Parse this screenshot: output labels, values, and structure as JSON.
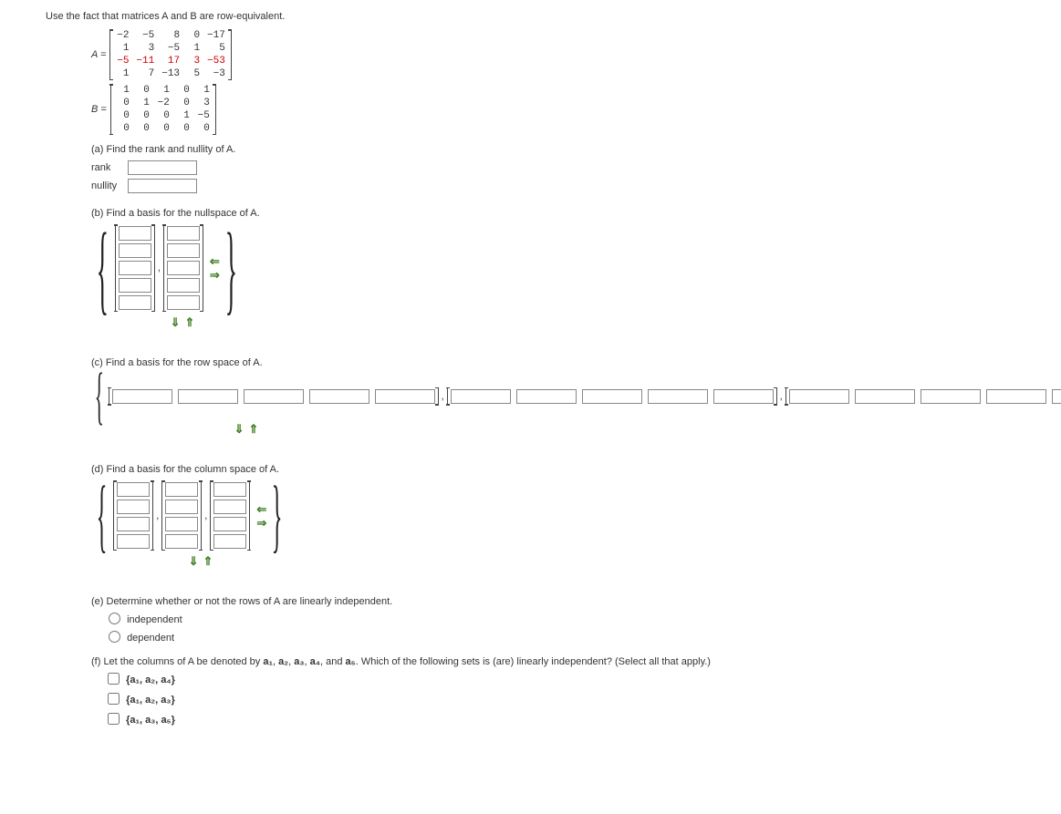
{
  "intro": "Use the fact that matrices A and B are row-equivalent.",
  "labelA": "A =",
  "labelB": "B =",
  "matrixA": [
    [
      "−2",
      "−5",
      "8",
      "0",
      "−17"
    ],
    [
      "1",
      "3",
      "−5",
      "1",
      "5"
    ],
    [
      "−5",
      "−11",
      "17",
      "3",
      "−53"
    ],
    [
      "1",
      "7",
      "−13",
      "5",
      "−3"
    ]
  ],
  "matrixB": [
    [
      "1",
      "0",
      "1",
      "0",
      "1"
    ],
    [
      "0",
      "1",
      "−2",
      "0",
      "3"
    ],
    [
      "0",
      "0",
      "0",
      "1",
      "−5"
    ],
    [
      "0",
      "0",
      "0",
      "0",
      "0"
    ]
  ],
  "partA": "(a) Find the rank and nullity of A.",
  "rankLabel": "rank",
  "nullityLabel": "nullity",
  "partB": "(b) Find a basis for the nullspace of A.",
  "partC": "(c) Find a basis for the row space of A.",
  "partD": "(d) Find a basis for the column space of A.",
  "partE": "(e) Determine whether or not the rows of A are linearly independent.",
  "radioOptions": [
    "independent",
    "dependent"
  ],
  "partF_prefix": "(f) Let the columns of A be denoted by ",
  "partF_suffix": ". Which of the following sets is (are) linearly independent? (Select all that apply.)",
  "colNames": [
    "a₁",
    "a₂",
    "a₃",
    "a₄",
    "a₅"
  ],
  "checkOptions": [
    "{a₁, a₂, a₄}",
    "{a₁, a₂, a₃}",
    "{a₁, a₃, a₅}"
  ],
  "comma": ", ",
  "and": ", and "
}
